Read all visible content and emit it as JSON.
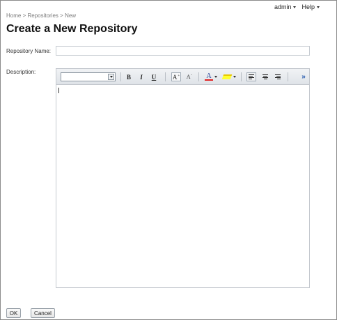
{
  "topnav": {
    "user": "admin",
    "help": "Help"
  },
  "breadcrumb": {
    "home": "Home",
    "sep1": " > ",
    "repositories": "Repositories",
    "sep2": " > ",
    "current": "New"
  },
  "page": {
    "title": "Create a New Repository"
  },
  "form": {
    "name_label": "Repository Name:",
    "name_value": "",
    "description_label": "Description:",
    "description_value": ""
  },
  "editor_toolbar": {
    "font_select_value": "",
    "bold": "B",
    "italic": "I",
    "underline": "U",
    "grow_font": "A",
    "shrink_font": "A",
    "font_color": "A",
    "more": "»",
    "icons": [
      "dropdown-caret-icon",
      "bold-icon",
      "italic-icon",
      "underline-icon",
      "grow-font-icon",
      "shrink-font-icon",
      "font-color-icon",
      "highlight-color-icon",
      "align-left-icon",
      "align-center-icon",
      "align-right-icon",
      "more-options-icon"
    ],
    "colors": {
      "font_color_bar": "#e02020",
      "highlight": "#ffff30",
      "more_link": "#2a5db0"
    }
  },
  "buttons": {
    "ok": "OK",
    "cancel": "Cancel"
  }
}
